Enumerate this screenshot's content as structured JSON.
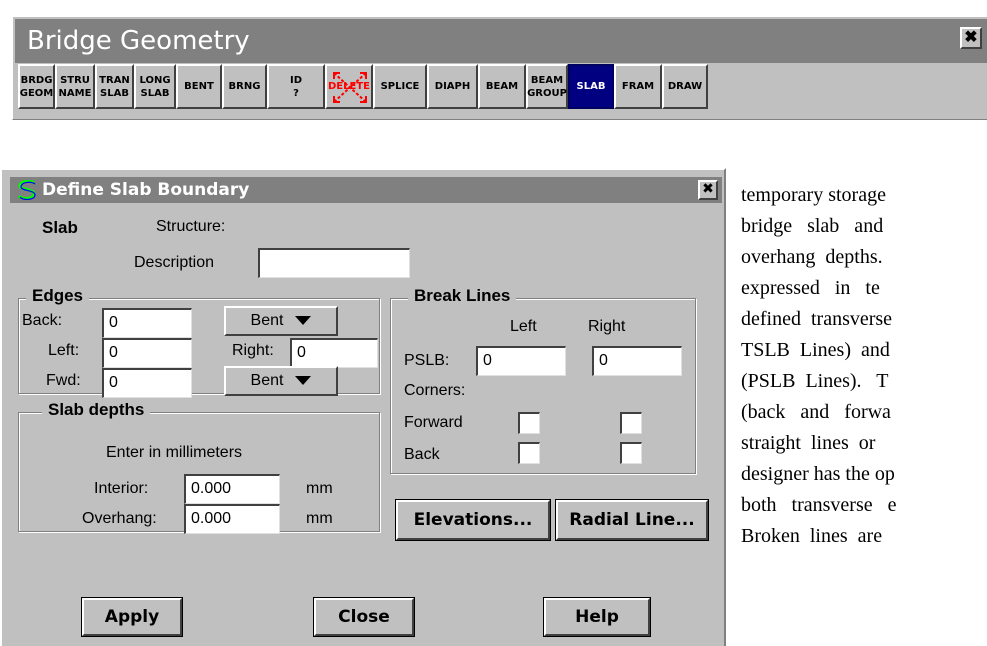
{
  "palette": {
    "title": "Bridge Geometry",
    "close_glyph": "✖",
    "buttons": [
      {
        "label": "BRDG\nGEOM",
        "active": false
      },
      {
        "label": "STRU\nNAME",
        "active": false
      },
      {
        "label": "TRAN\nSLAB",
        "active": false
      },
      {
        "label": "LONG\nSLAB",
        "active": false
      },
      {
        "label": "BENT",
        "active": false
      },
      {
        "label": "BRNG",
        "active": false
      },
      {
        "label": "ID\n?",
        "active": false
      },
      {
        "label": "DELETE",
        "active": false
      },
      {
        "label": "SPLICE",
        "active": false
      },
      {
        "label": "DIAPH",
        "active": false
      },
      {
        "label": "BEAM",
        "active": false
      },
      {
        "label": "BEAM\nGROUP",
        "active": false
      },
      {
        "label": "SLAB",
        "active": true
      },
      {
        "label": "FRAM",
        "active": false
      },
      {
        "label": "DRAW",
        "active": false
      }
    ]
  },
  "dialog": {
    "title": "Define Slab Boundary",
    "app_icon": "s-logo-icon",
    "close_glyph": "✖",
    "slab_label": "Slab",
    "structure_label": "Structure:",
    "description_label": "Description",
    "description_value": "",
    "edges": {
      "legend": "Edges",
      "back_label": "Back:",
      "back_value": "0",
      "back_type": "Bent",
      "left_label": "Left:",
      "left_value": "0",
      "right_label": "Right:",
      "right_value": "0",
      "fwd_label": "Fwd:",
      "fwd_value": "0",
      "fwd_type": "Bent"
    },
    "break_lines": {
      "legend": "Break Lines",
      "left_header": "Left",
      "right_header": "Right",
      "pslb_label": "PSLB:",
      "pslb_left": "0",
      "pslb_right": "0",
      "corners_label": "Corners:",
      "forward_label": "Forward",
      "back_label": "Back"
    },
    "slab_depths": {
      "legend": "Slab depths",
      "hint": "Enter in millimeters",
      "interior_label": "Interior:",
      "interior_value": "0.000",
      "overhang_label": "Overhang:",
      "overhang_value": "0.000",
      "unit": "mm"
    },
    "buttons": {
      "elevations": "Elevations...",
      "radial_line": "Radial Line...",
      "apply": "Apply",
      "close": "Close",
      "help": "Help"
    }
  },
  "document": {
    "lines": [
      "temporary storage",
      "bridge   slab   and",
      "overhang  depths.",
      "expressed   in   te",
      "defined  transverse",
      "TSLB  Lines)  and",
      "(PSLB  Lines).   T",
      "(back   and   forwa",
      "straight  lines  or",
      "designer has the op",
      "both   transverse   e",
      "Broken  lines  are"
    ]
  },
  "colors": {
    "face": "#c0c0c0",
    "title_bar": "#808080",
    "active_button": "#000080",
    "delete_red": "#ff0000"
  }
}
